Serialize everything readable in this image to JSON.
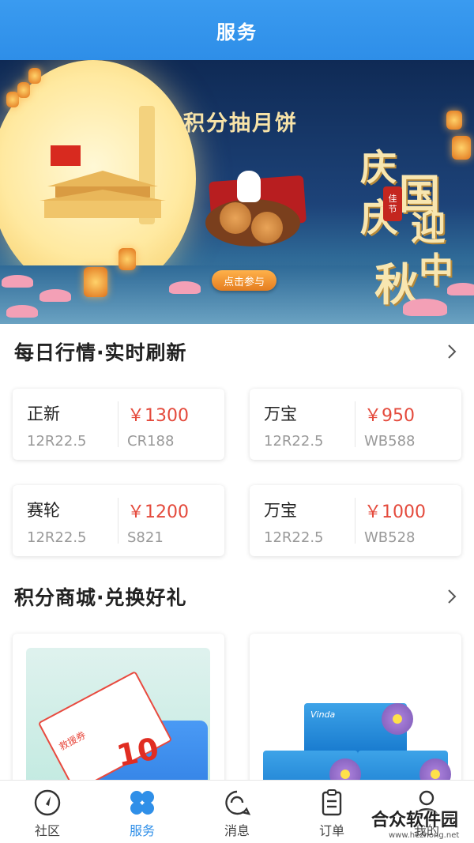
{
  "header": {
    "title": "服务"
  },
  "banner": {
    "title": "积分抽月饼",
    "cta": "点击参与",
    "calligraphy": [
      "庆",
      "国",
      "庆",
      "迎",
      "中",
      "秋"
    ],
    "seal": [
      "佳",
      "节"
    ]
  },
  "daily_market": {
    "title": "每日行情·实时刷新",
    "cards": [
      {
        "brand": "正新",
        "size": "12R22.5",
        "price": "￥1300",
        "model": "CR188"
      },
      {
        "brand": "万宝",
        "size": "12R22.5",
        "price": "￥950",
        "model": "WB588"
      },
      {
        "brand": "赛轮",
        "size": "12R22.5",
        "price": "￥1200",
        "model": "S821"
      },
      {
        "brand": "万宝",
        "size": "12R22.5",
        "price": "￥1000",
        "model": "WB528"
      }
    ]
  },
  "points_mall": {
    "title": "积分商城·兑换好礼",
    "items": [
      {
        "ticket_number": "10",
        "ticket_text": "救援券"
      },
      {
        "tissue_brand": "Vinda"
      }
    ]
  },
  "tabbar": {
    "tabs": [
      {
        "label": "社区",
        "icon": "compass-icon"
      },
      {
        "label": "服务",
        "icon": "grid-petals-icon",
        "active": true
      },
      {
        "label": "消息",
        "icon": "chat-bubble-icon"
      },
      {
        "label": "订单",
        "icon": "clipboard-icon"
      },
      {
        "label": "我的",
        "icon": "user-icon"
      }
    ]
  },
  "watermark": {
    "text": "合众软件园",
    "url": "www.hezhong.net"
  },
  "colors": {
    "primary": "#2f8fe8",
    "price": "#e44a3c"
  }
}
